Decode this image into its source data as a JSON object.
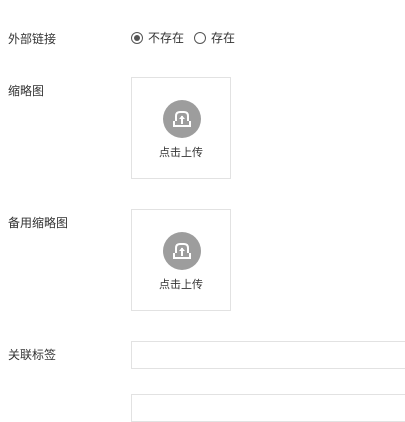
{
  "fields": {
    "external_link": {
      "label": "外部链接",
      "options": [
        {
          "label": "不存在",
          "checked": true
        },
        {
          "label": "存在",
          "checked": false
        }
      ]
    },
    "thumbnail": {
      "label": "缩略图",
      "upload_text": "点击上传",
      "icon": "cloud-upload-icon"
    },
    "backup_thumbnail": {
      "label": "备用缩略图",
      "upload_text": "点击上传",
      "icon": "cloud-upload-icon"
    },
    "related_tags": {
      "label": "关联标签",
      "value": "",
      "placeholder": ""
    },
    "next_field": {
      "value": ""
    }
  },
  "colors": {
    "text": "#333333",
    "border": "#e2e2e2",
    "icon_bg": "#9d9d9d",
    "radio": "#555555"
  }
}
